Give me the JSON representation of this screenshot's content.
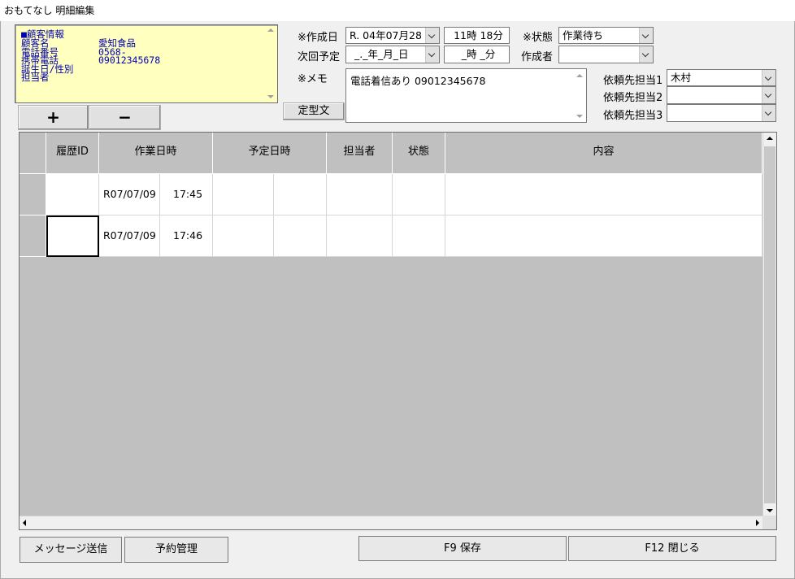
{
  "window": {
    "title": "おもてなし 明細編集"
  },
  "customer_info": {
    "heading": "■顧客情報",
    "labels": [
      "顧客名",
      "電話番号",
      "携帯電話",
      "誕生日/性別",
      "担当者"
    ],
    "values": [
      "愛知食品",
      "0568-",
      "09012345678",
      "",
      ""
    ]
  },
  "add_button": {
    "label": "+"
  },
  "remove_button": {
    "label": "−"
  },
  "form": {
    "created_date_label": "※作成日",
    "created_date_value": "R. 04年07月28",
    "created_time_value": "11時 18分",
    "status_label": "※状態",
    "status_value": "作業待ち",
    "next_date_label": "次回予定",
    "next_date_value": "_._年_月_日",
    "next_time_value": "_時 _分",
    "creator_label": "作成者",
    "creator_value": "",
    "memo_label": "※メモ",
    "memo_value": "電話着信あり 09012345678",
    "template_button": "定型文",
    "assignee1_label": "依頼先担当1",
    "assignee1_value": "木村",
    "assignee2_label": "依頼先担当2",
    "assignee2_value": "",
    "assignee3_label": "依頼先担当3",
    "assignee3_value": ""
  },
  "grid": {
    "columns": [
      "",
      "履歴ID",
      "作業日時",
      "予定日時",
      "担当者",
      "状態",
      "内容"
    ],
    "rows": [
      {
        "id": "",
        "work_date": "R07/07/09",
        "work_time": "17:45",
        "plan_date": "",
        "plan_time": "",
        "staff": "",
        "status": "",
        "content": ""
      },
      {
        "id": "",
        "work_date": "R07/07/09",
        "work_time": "17:46",
        "plan_date": "",
        "plan_time": "",
        "staff": "",
        "status": "",
        "content": ""
      }
    ]
  },
  "footer": {
    "message_button": "メッセージ送信",
    "reservation_button": "予約管理",
    "save_button": "F9 保存",
    "close_button": "F12 閉じる"
  }
}
